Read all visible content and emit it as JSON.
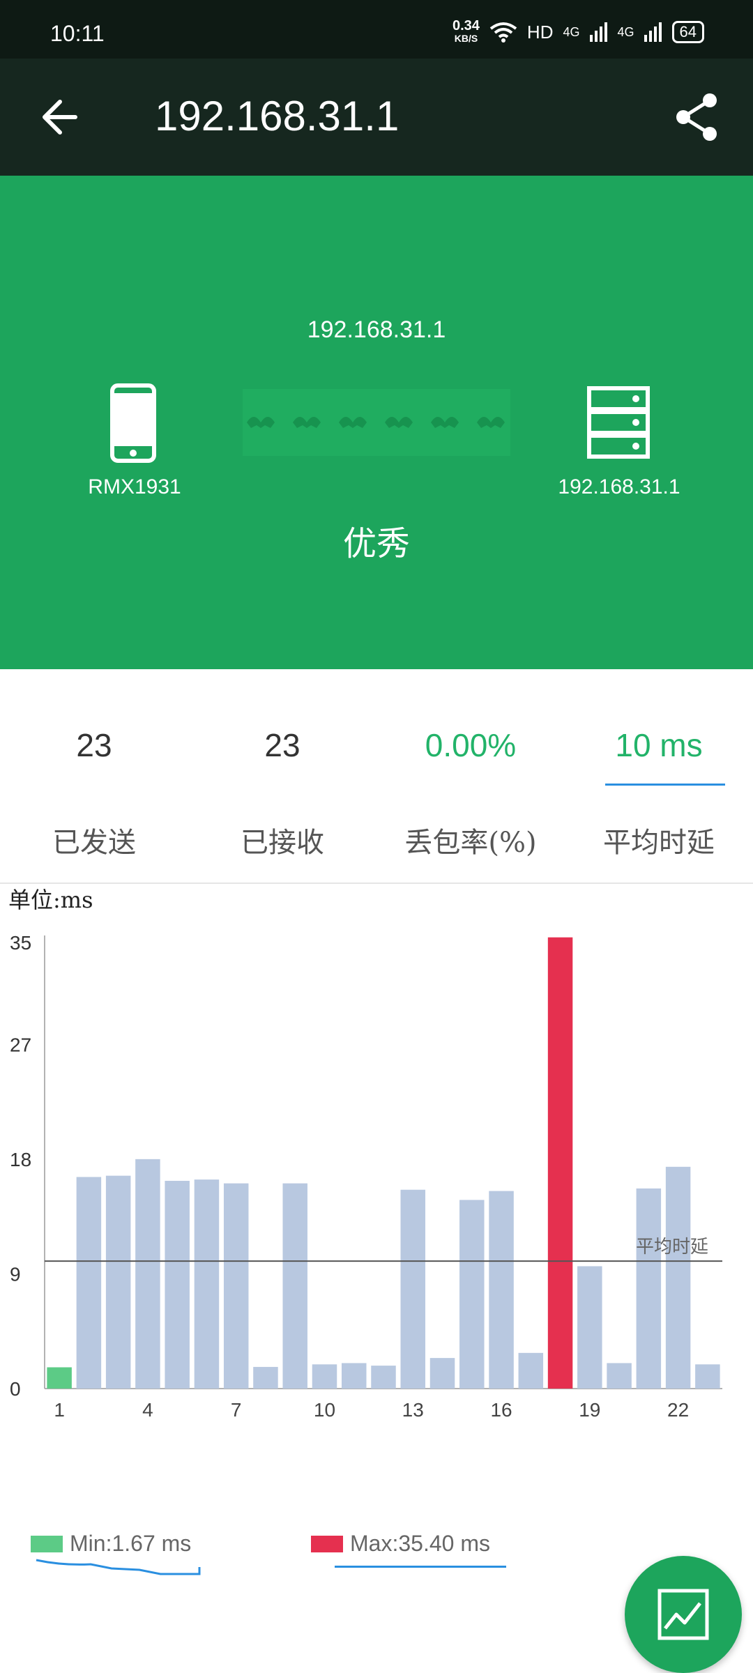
{
  "status_bar": {
    "time": "10:11",
    "net_speed": "0.34",
    "net_unit": "KB/S",
    "hd": "HD",
    "signal1": "4G",
    "signal2": "4G",
    "battery": "64"
  },
  "app_bar": {
    "title": "192.168.31.1",
    "back_icon": "arrow-left-icon",
    "share_icon": "share-icon"
  },
  "hero": {
    "target_ip": "192.168.31.1",
    "device_label": "RMX1931",
    "server_label": "192.168.31.1",
    "quality": "优秀",
    "background": "#1da55c"
  },
  "stats": [
    {
      "value": "23",
      "label": "已发送"
    },
    {
      "value": "23",
      "label": "已接收"
    },
    {
      "value": "0.00%",
      "label": "丢包率(%)"
    },
    {
      "value": "10 ms",
      "label": "平均时延"
    }
  ],
  "chart_unit": "单位:ms",
  "chart_data": {
    "type": "bar",
    "x_tick_labels": [
      "1",
      "4",
      "7",
      "10",
      "13",
      "16",
      "19",
      "22"
    ],
    "y_tick_labels": [
      "0",
      "9",
      "18",
      "27",
      "35"
    ],
    "ylim": [
      0,
      35
    ],
    "values": [
      1.67,
      16.6,
      16.7,
      18.0,
      16.3,
      16.4,
      16.1,
      1.7,
      16.1,
      1.9,
      2.0,
      1.8,
      15.6,
      2.4,
      14.8,
      15.5,
      2.8,
      35.4,
      9.6,
      2.0,
      15.7,
      17.4,
      1.9
    ],
    "min_index": 0,
    "max_index": 17,
    "avg_value": 10,
    "avg_label": "平均时延",
    "colors": {
      "normal": "#b8c8e0",
      "min": "#5ccb86",
      "max": "#e5304f",
      "avg_line": "#555555"
    }
  },
  "legend": {
    "min_label": "Min:1.67 ms",
    "max_label": "Max:35.40 ms"
  },
  "fab_icon": "trend-chart-icon"
}
